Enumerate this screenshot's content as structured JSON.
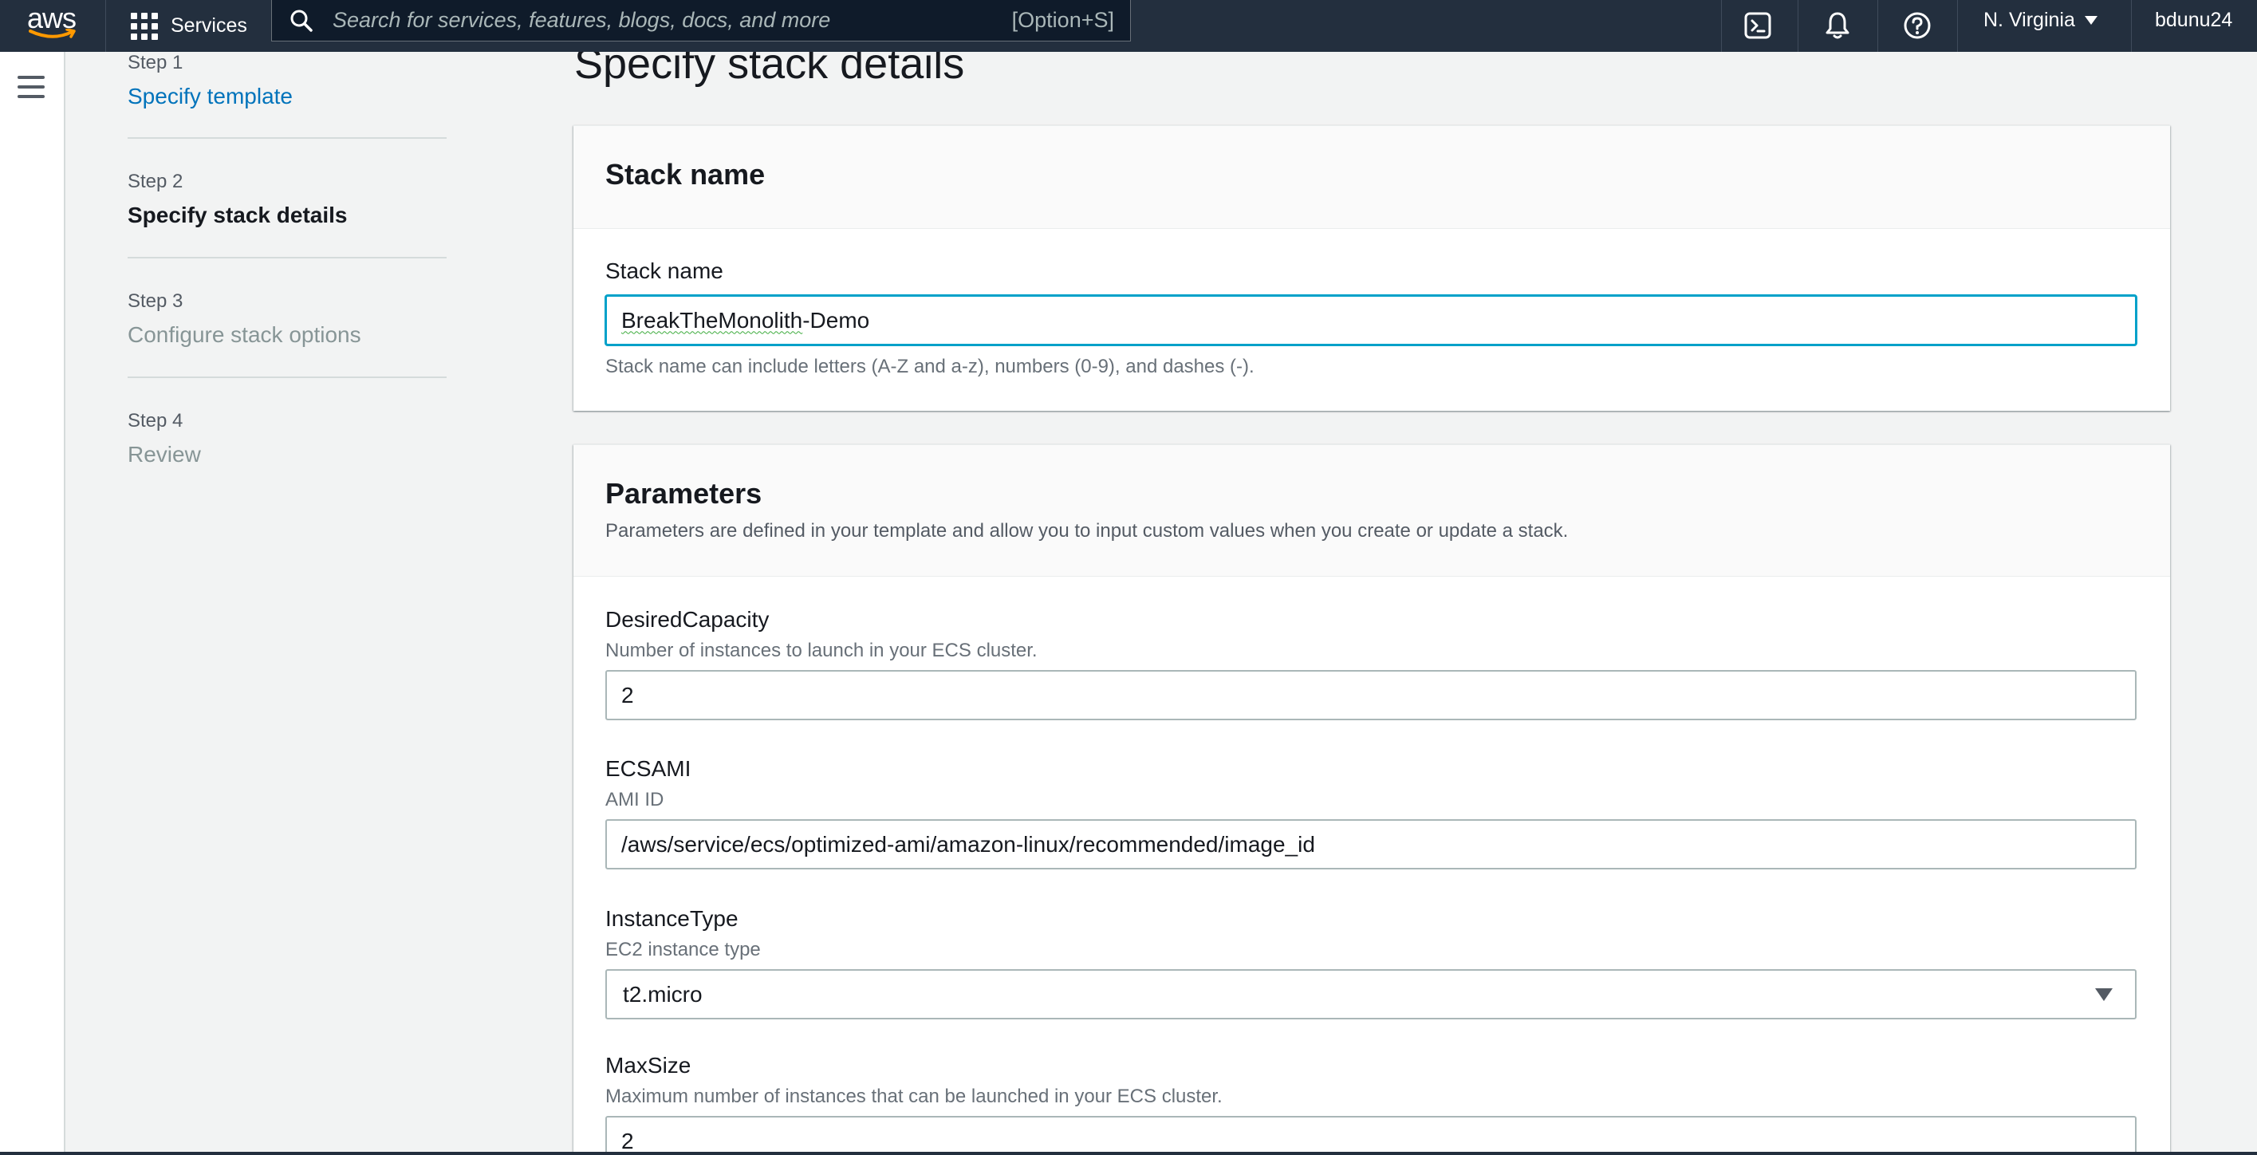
{
  "nav": {
    "logo": "aws",
    "services_label": "Services",
    "search_placeholder": "Search for services, features, blogs, docs, and more",
    "search_shortcut": "[Option+S]",
    "region": "N. Virginia",
    "user": "bdunu24",
    "icons": [
      "cloudshell-icon",
      "bell-icon",
      "help-icon"
    ],
    "bg_color": "#232f3e"
  },
  "steps": [
    {
      "num": "Step 1",
      "title": "Specify template",
      "state": "link"
    },
    {
      "num": "Step 2",
      "title": "Specify stack details",
      "state": "current"
    },
    {
      "num": "Step 3",
      "title": "Configure stack options",
      "state": "disabled"
    },
    {
      "num": "Step 4",
      "title": "Review",
      "state": "disabled"
    }
  ],
  "main": {
    "page_title": "Specify stack details",
    "stack_panel": {
      "title": "Stack name",
      "field_label": "Stack name",
      "value_underlined": "BreakTheMonolith",
      "value_rest": "-Demo",
      "constraint": "Stack name can include letters (A-Z and a-z), numbers (0-9), and dashes (-)."
    },
    "params_panel": {
      "title": "Parameters",
      "description": "Parameters are defined in your template and allow you to input custom values when you create or update a stack.",
      "fields": [
        {
          "label": "DesiredCapacity",
          "desc": "Number of instances to launch in your ECS cluster.",
          "value": "2",
          "type": "text"
        },
        {
          "label": "ECSAMI",
          "desc": "AMI ID",
          "value": "/aws/service/ecs/optimized-ami/amazon-linux/recommended/image_id",
          "type": "text"
        },
        {
          "label": "InstanceType",
          "desc": "EC2 instance type",
          "value": "t2.micro",
          "type": "select"
        },
        {
          "label": "MaxSize",
          "desc": "Maximum number of instances that can be launched in your ECS cluster.",
          "value": "2",
          "type": "text"
        }
      ]
    }
  },
  "colors": {
    "accent_link": "#0073bb",
    "focus_border": "#00a1c9",
    "page_bg": "#f2f3f3"
  }
}
